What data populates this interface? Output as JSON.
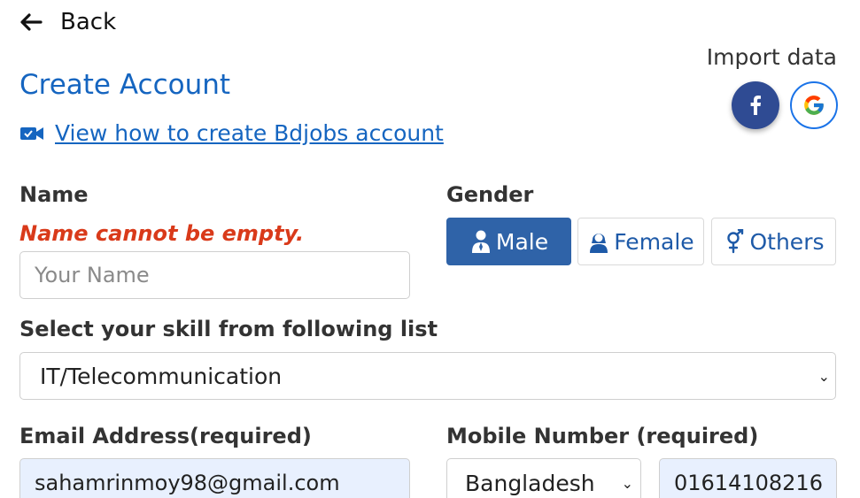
{
  "nav": {
    "back_label": "Back"
  },
  "page": {
    "title": "Create Account"
  },
  "video": {
    "link_text": "View how to create Bdjobs account"
  },
  "import": {
    "label": "Import data",
    "facebook_icon": "facebook-icon",
    "google_icon": "google-icon"
  },
  "name_field": {
    "label": "Name",
    "error": "Name cannot be empty.",
    "placeholder": "Your Name",
    "value": ""
  },
  "gender": {
    "label": "Gender",
    "options": [
      {
        "label": "Male",
        "icon": "male-user-icon",
        "selected": true
      },
      {
        "label": "Female",
        "icon": "female-user-icon",
        "selected": false
      },
      {
        "label": "Others",
        "icon": "genderqueer-icon",
        "selected": false
      }
    ]
  },
  "skill": {
    "label": "Select your skill from following list",
    "selected": "IT/Telecommunication"
  },
  "email": {
    "label": "Email Address(required)",
    "value": "sahamrinmoy98@gmail.com"
  },
  "mobile": {
    "label": "Mobile Number (required)",
    "country": "Bangladesh",
    "value": "01614108216"
  },
  "colors": {
    "accent": "#1565c0",
    "error": "#d93a1a",
    "button_active": "#2f63a8",
    "autofill": "#e8f0fe"
  }
}
